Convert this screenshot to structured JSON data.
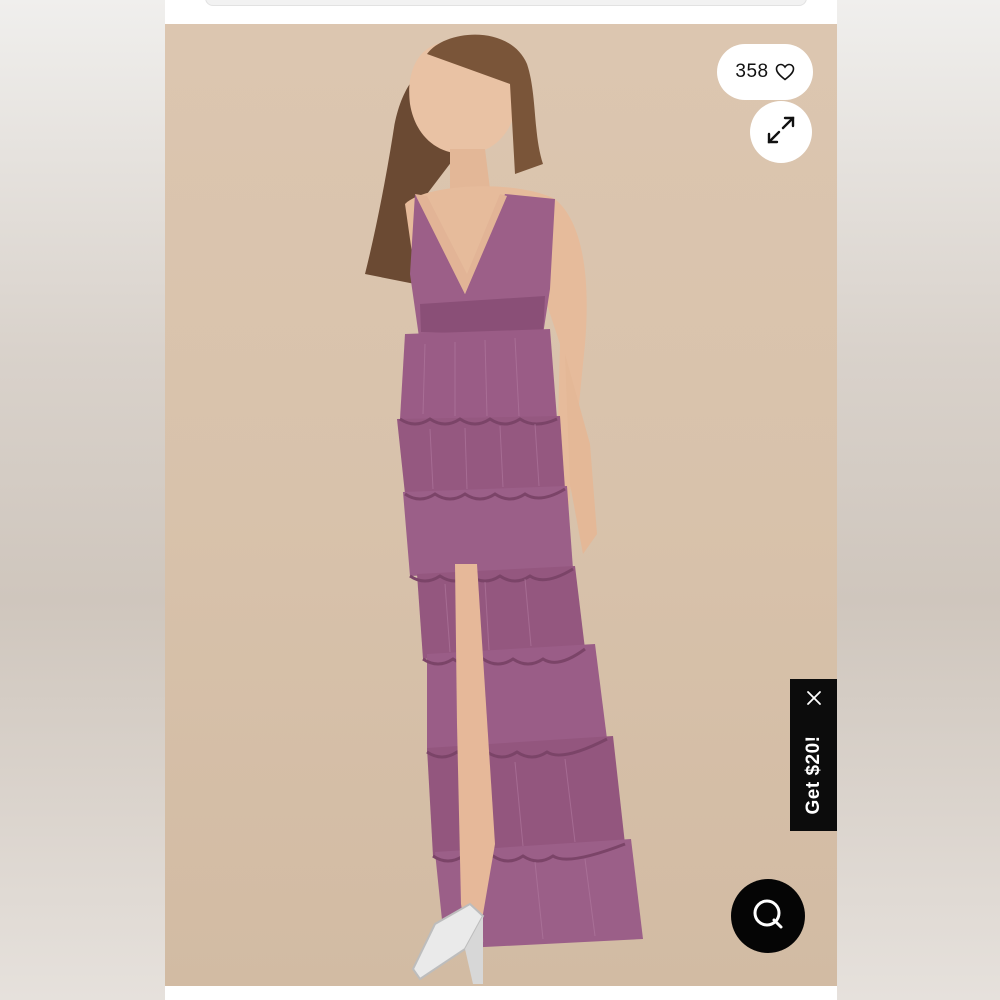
{
  "product_image": {
    "like_count": "358",
    "icons": {
      "like": "heart-outline-icon",
      "expand": "expand-arrows-icon",
      "close": "close-x-icon",
      "chat": "chat-bubble-icon"
    }
  },
  "promo": {
    "label": "Get $20!"
  },
  "colors": {
    "backdrop": "#d8c2ab",
    "dress": "#9a5f86",
    "promo_bg": "#0c0c0c",
    "chat_bg": "#050505"
  }
}
